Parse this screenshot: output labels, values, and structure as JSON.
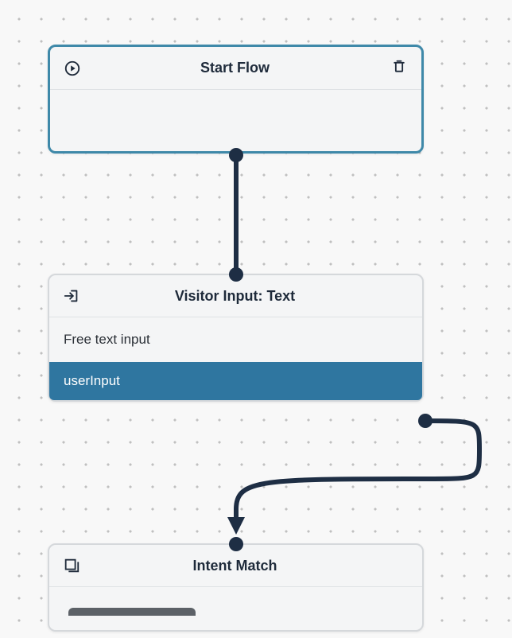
{
  "nodes": {
    "start": {
      "title": "Start Flow",
      "icon": "play-circle",
      "has_trash": true
    },
    "visitor_input": {
      "title": "Visitor Input: Text",
      "icon": "input-arrow",
      "body": "Free text input",
      "output_label": "userInput"
    },
    "intent_match": {
      "title": "Intent Match",
      "icon": "stack"
    }
  }
}
